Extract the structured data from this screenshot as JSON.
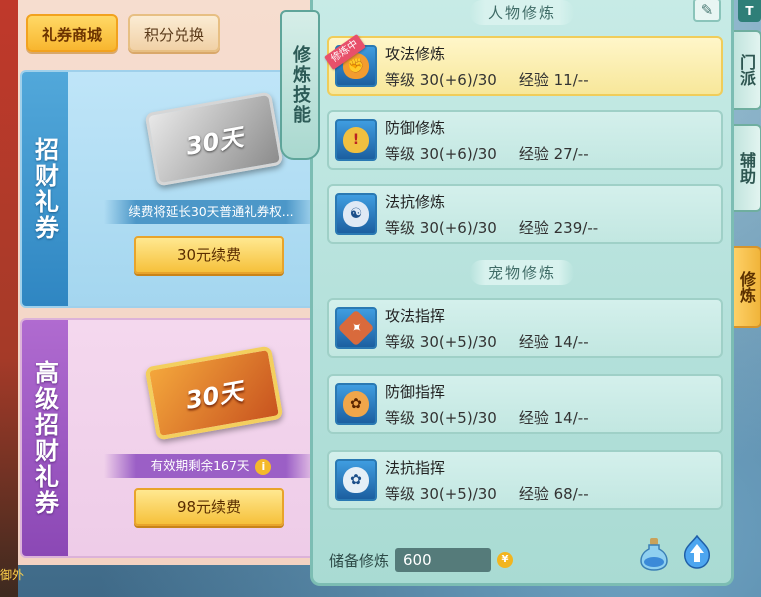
{
  "shop": {
    "tabs": [
      {
        "label": "礼券商城",
        "active": true
      },
      {
        "label": "积分兑换",
        "active": false
      }
    ],
    "cards": [
      {
        "side_label": "招财礼券",
        "ticket_text": "30天",
        "note": "续费将延长30天普通礼券权...",
        "button": "30元续费"
      },
      {
        "side_label": "高级招财礼券",
        "ticket_text": "30天",
        "note": "有效期剩余167天",
        "button": "98元续费"
      }
    ]
  },
  "skill_tab_label": "修炼技能",
  "panel": {
    "people_title": "人物修炼",
    "pet_title": "宠物修炼",
    "level_label": "等级",
    "exp_label": "经验",
    "training_badge": "修炼中",
    "people_skills": [
      {
        "name": "攻法修炼",
        "level": "30(+6)/30",
        "exp": "11/--",
        "active": true
      },
      {
        "name": "防御修炼",
        "level": "30(+6)/30",
        "exp": "27/--",
        "active": false
      },
      {
        "name": "法抗修炼",
        "level": "30(+6)/30",
        "exp": "239/--",
        "active": false
      }
    ],
    "pet_skills": [
      {
        "name": "攻法指挥",
        "level": "30(+5)/30",
        "exp": "14/--"
      },
      {
        "name": "防御指挥",
        "level": "30(+5)/30",
        "exp": "14/--"
      },
      {
        "name": "法抗指挥",
        "level": "30(+5)/30",
        "exp": "68/--"
      }
    ],
    "reserve_label": "储备修炼",
    "reserve_value": "600"
  },
  "side_tabs": [
    {
      "label": "门派"
    },
    {
      "label": "辅助"
    },
    {
      "label": "修炼",
      "active": true
    }
  ],
  "top_corner_label": "T",
  "bottom_left_text": "御外"
}
